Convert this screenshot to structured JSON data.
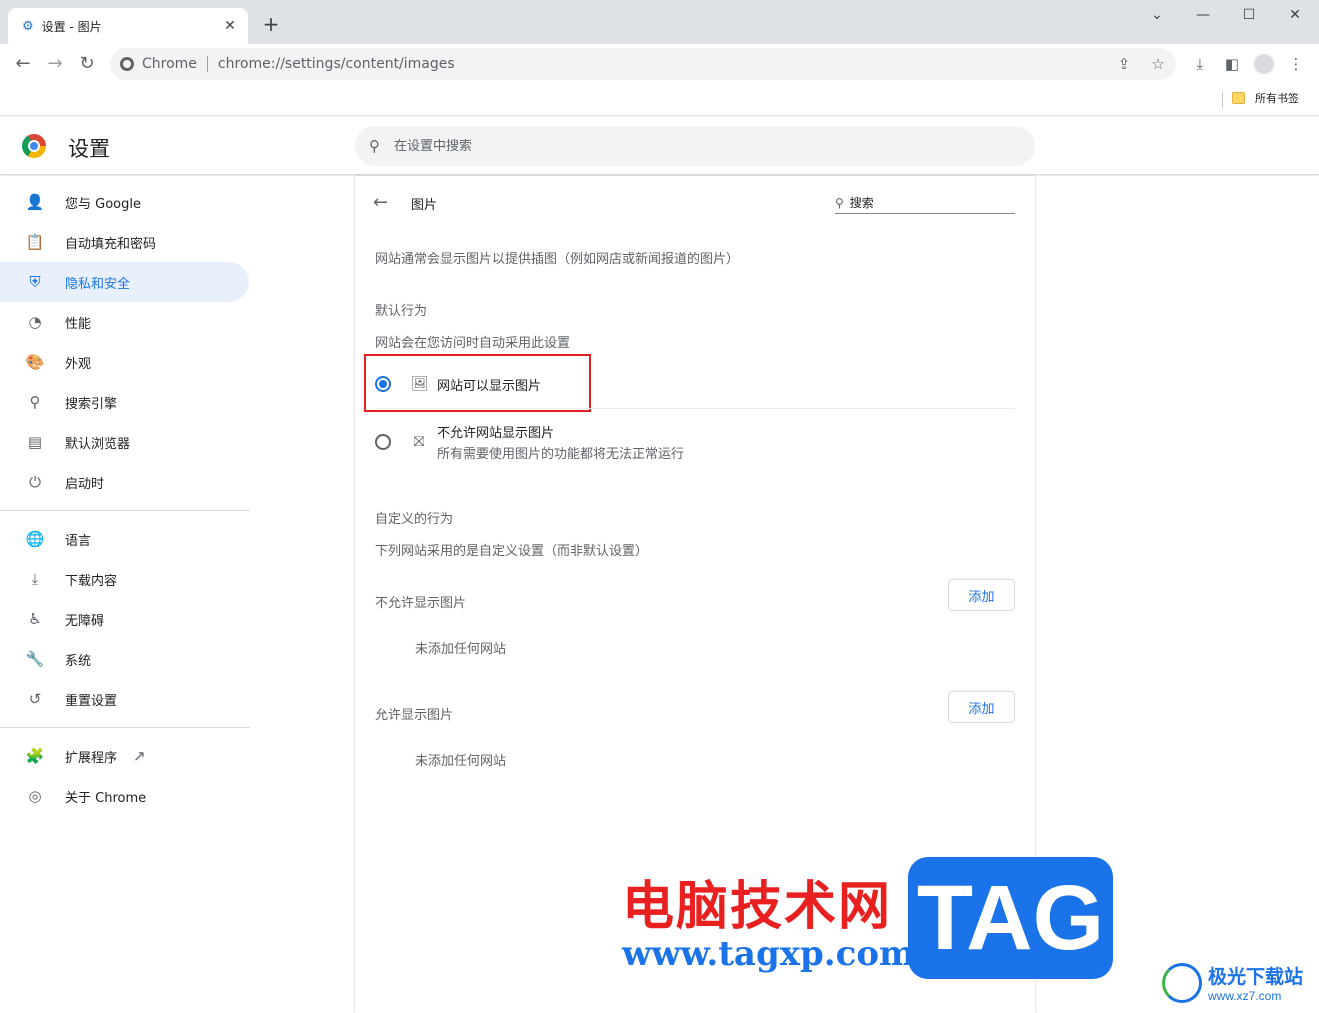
{
  "browser": {
    "tab_title": "设置 - 图片",
    "new_tab": "+",
    "omnibox_site": "Chrome",
    "omnibox_url": "chrome://settings/content/images",
    "bookmark_folder": "所有书签"
  },
  "header": {
    "title": "设置",
    "search_placeholder": "在设置中搜索"
  },
  "sidebar": {
    "items": [
      {
        "label": "您与 Google",
        "icon": "person-icon"
      },
      {
        "label": "自动填充和密码",
        "icon": "clipboard-icon"
      },
      {
        "label": "隐私和安全",
        "icon": "shield-icon",
        "active": true
      },
      {
        "label": "性能",
        "icon": "speedometer-icon"
      },
      {
        "label": "外观",
        "icon": "palette-icon"
      },
      {
        "label": "搜索引擎",
        "icon": "search-icon"
      },
      {
        "label": "默认浏览器",
        "icon": "browser-window-icon"
      },
      {
        "label": "启动时",
        "icon": "power-icon"
      },
      {
        "label": "语言",
        "icon": "globe-icon"
      },
      {
        "label": "下载内容",
        "icon": "download-icon"
      },
      {
        "label": "无障碍",
        "icon": "accessibility-icon"
      },
      {
        "label": "系统",
        "icon": "wrench-icon"
      },
      {
        "label": "重置设置",
        "icon": "history-icon"
      },
      {
        "label": "扩展程序",
        "icon": "puzzle-icon"
      },
      {
        "label": "关于 Chrome",
        "icon": "chrome-icon"
      }
    ]
  },
  "page": {
    "title": "图片",
    "search_placeholder": "搜索",
    "description": "网站通常会显示图片以提供插图（例如网店或新闻报道的图片）",
    "default_behavior": {
      "title": "默认行为",
      "subtitle": "网站会在您访问时自动采用此设置",
      "options": [
        {
          "label": "网站可以显示图片",
          "sub": "",
          "checked": true
        },
        {
          "label": "不允许网站显示图片",
          "sub": "所有需要使用图片的功能都将无法正常运行",
          "checked": false
        }
      ]
    },
    "custom_behavior": {
      "title": "自定义的行为",
      "subtitle": "下列网站采用的是自定义设置（而非默认设置）",
      "blocked": {
        "title": "不允许显示图片",
        "add_label": "添加",
        "empty": "未添加任何网站"
      },
      "allowed": {
        "title": "允许显示图片",
        "add_label": "添加",
        "empty": "未添加任何网站"
      }
    }
  },
  "watermark": {
    "cn_title": "电脑技术网",
    "url": "www.tagxp.com",
    "tag": "TAG",
    "jg_name": "极光下载站",
    "jg_url": "www.xz7.com"
  },
  "colors": {
    "accent": "#1a73e8",
    "highlight_border": "#e02020",
    "active_bg": "#e8f0fe"
  }
}
